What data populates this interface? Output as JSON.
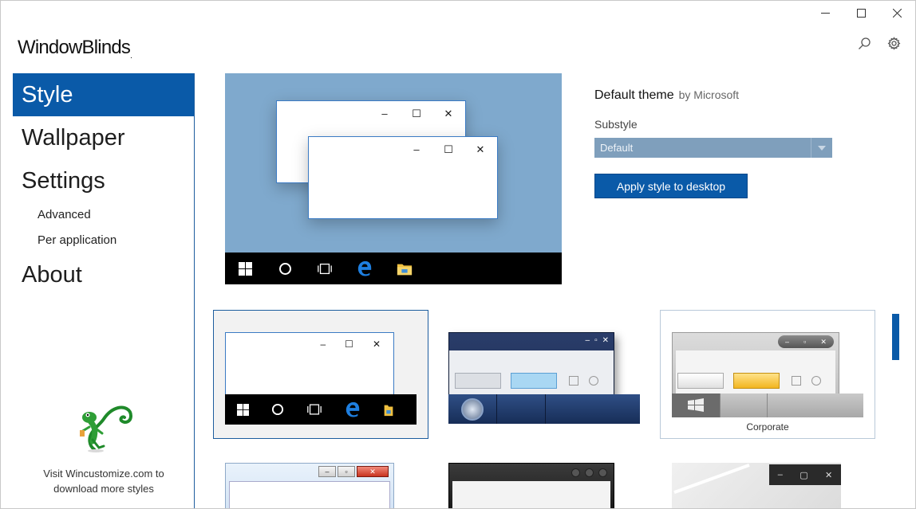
{
  "app": {
    "title": "WindowBlinds",
    "trademark": "."
  },
  "window_controls": {
    "minimize": "minimize-icon",
    "maximize": "maximize-icon",
    "close": "close-icon"
  },
  "toolbar": {
    "search": "search-icon",
    "settings": "gear-icon"
  },
  "nav": {
    "style": "Style",
    "wallpaper": "Wallpaper",
    "settings": "Settings",
    "advanced": "Advanced",
    "per_application": "Per application",
    "about": "About"
  },
  "promo": {
    "line1": "Visit Wincustomize.com to",
    "line2": "download more styles"
  },
  "theme": {
    "name": "Default theme",
    "author": "by Microsoft",
    "substyle_label": "Substyle",
    "substyle_value": "Default",
    "apply_label": "Apply style to desktop"
  },
  "thumbnails": [
    {
      "caption": ""
    },
    {
      "caption": ""
    },
    {
      "caption": "Corporate"
    }
  ],
  "colors": {
    "accent": "#0a5aa8",
    "preview_bg": "#7fa9cd",
    "taskbar": "#000000"
  }
}
